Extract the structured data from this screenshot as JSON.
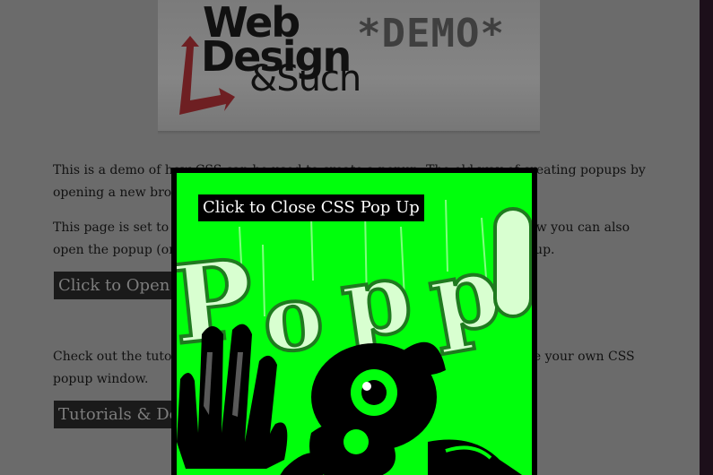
{
  "header": {
    "logo_line1": "Web",
    "logo_line2": "Design",
    "logo_line3": "&Such",
    "logo_tag": "*DEMO*"
  },
  "content": {
    "paragraph1": "This is a demo of how CSS can be used to create a popup. The old way of creating popups by opening a new browser window",
    "paragraph2": "This page is set to open the popup when the page loads. Using the link below you can also open the popup (once it's closed) by clicking the link below to open the popup.",
    "open_button": "Click to Open CSS Pop Up",
    "paragraph3": "Check out the tutorial and download the source code you will need to create your own CSS popup window.",
    "tutorials_button": "Tutorials & Downloads"
  },
  "popup": {
    "close_label": "Click to Close CSS Pop Up",
    "art_icon": "pop-graffiti-art"
  },
  "colors": {
    "overlay": "#6b6b6b",
    "popup_bg": "#00ff0c",
    "popup_border": "#000000",
    "button_bg": "#1a1a1a"
  }
}
